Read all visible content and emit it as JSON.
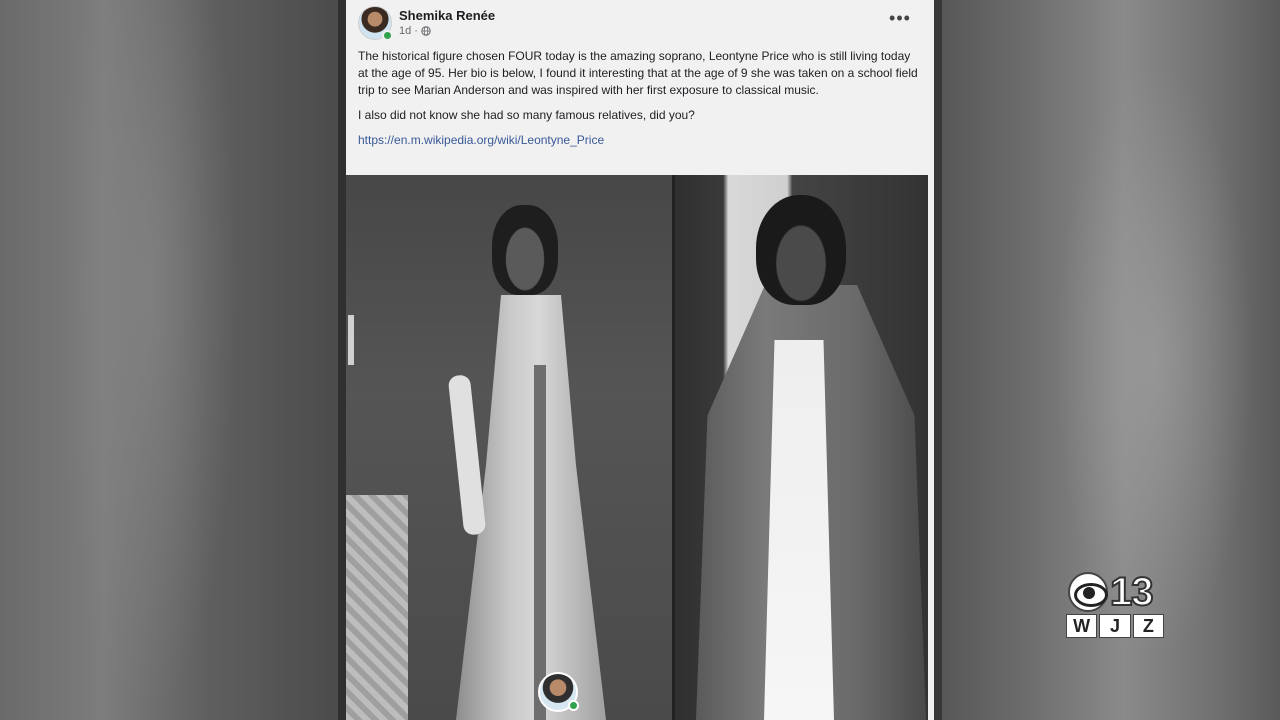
{
  "post": {
    "author": "Shemika Renée",
    "time": "1d",
    "privacy_icon": "globe-icon",
    "more_icon": "more-options-icon",
    "paragraph1": "The historical figure chosen FOUR today is the amazing soprano, Leontyne Price who is still living today at the age of 95. Her bio is below, I found it interesting that at the age of 9 she was taken on a school field trip to see Marian Anderson and was inspired with her first exposure to classical music.",
    "paragraph2": "I also did not know she had so many famous relatives, did you?",
    "link": "https://en.m.wikipedia.org/wiki/Leontyne_Price"
  },
  "logo": {
    "number": "13",
    "call_letters": [
      "W",
      "J",
      "Z"
    ]
  },
  "colors": {
    "online": "#31a24c",
    "link": "#385898",
    "card": "#f1f1f1"
  }
}
